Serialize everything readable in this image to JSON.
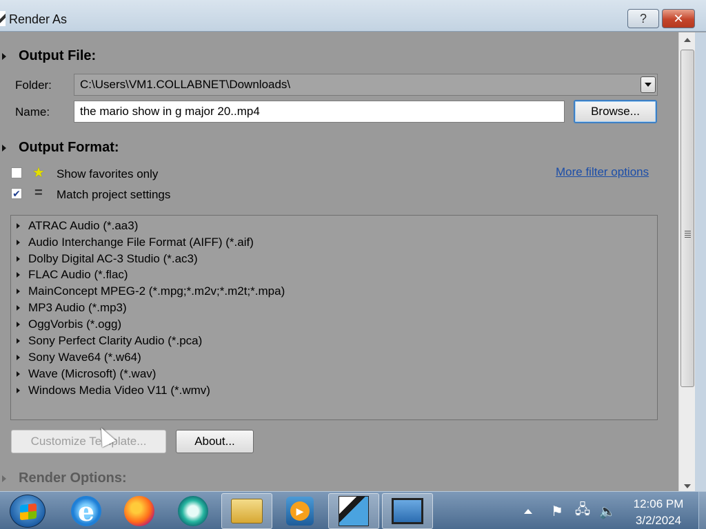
{
  "window": {
    "title": "Render As",
    "help_label": "?",
    "close_label": "✕"
  },
  "output_file": {
    "section_title": "Output File:",
    "folder_label": "Folder:",
    "folder_value": "C:\\Users\\VM1.COLLABNET\\Downloads\\",
    "name_label": "Name:",
    "name_value": "the mario show  in g major 20..mp4",
    "browse_label": "Browse..."
  },
  "output_format": {
    "section_title": "Output Format:",
    "show_favorites_label": "Show favorites only",
    "show_favorites_checked": false,
    "match_project_label": "Match project settings",
    "match_project_checked": true,
    "more_filter_label": "More filter options",
    "formats": [
      "ATRAC Audio (*.aa3)",
      "Audio Interchange File Format (AIFF) (*.aif)",
      "Dolby Digital AC-3 Studio (*.ac3)",
      "FLAC Audio (*.flac)",
      "MainConcept MPEG-2 (*.mpg;*.m2v;*.m2t;*.mpa)",
      "MP3 Audio (*.mp3)",
      "OggVorbis (*.ogg)",
      "Sony Perfect Clarity Audio (*.pca)",
      "Sony Wave64 (*.w64)",
      "Wave (Microsoft) (*.wav)",
      "Windows Media Video V11 (*.wmv)"
    ]
  },
  "actions": {
    "customize_label": "Customize Template...",
    "about_label": "About..."
  },
  "render_options": {
    "section_title": "Render Options:"
  },
  "taskbar": {
    "time": "12:06 PM",
    "date": "3/2/2024",
    "ie_glyph": "e",
    "media_glyph": "▶",
    "flag_glyph": "⚑",
    "network_glyph": "🖧",
    "volume_glyph": "🔈"
  }
}
